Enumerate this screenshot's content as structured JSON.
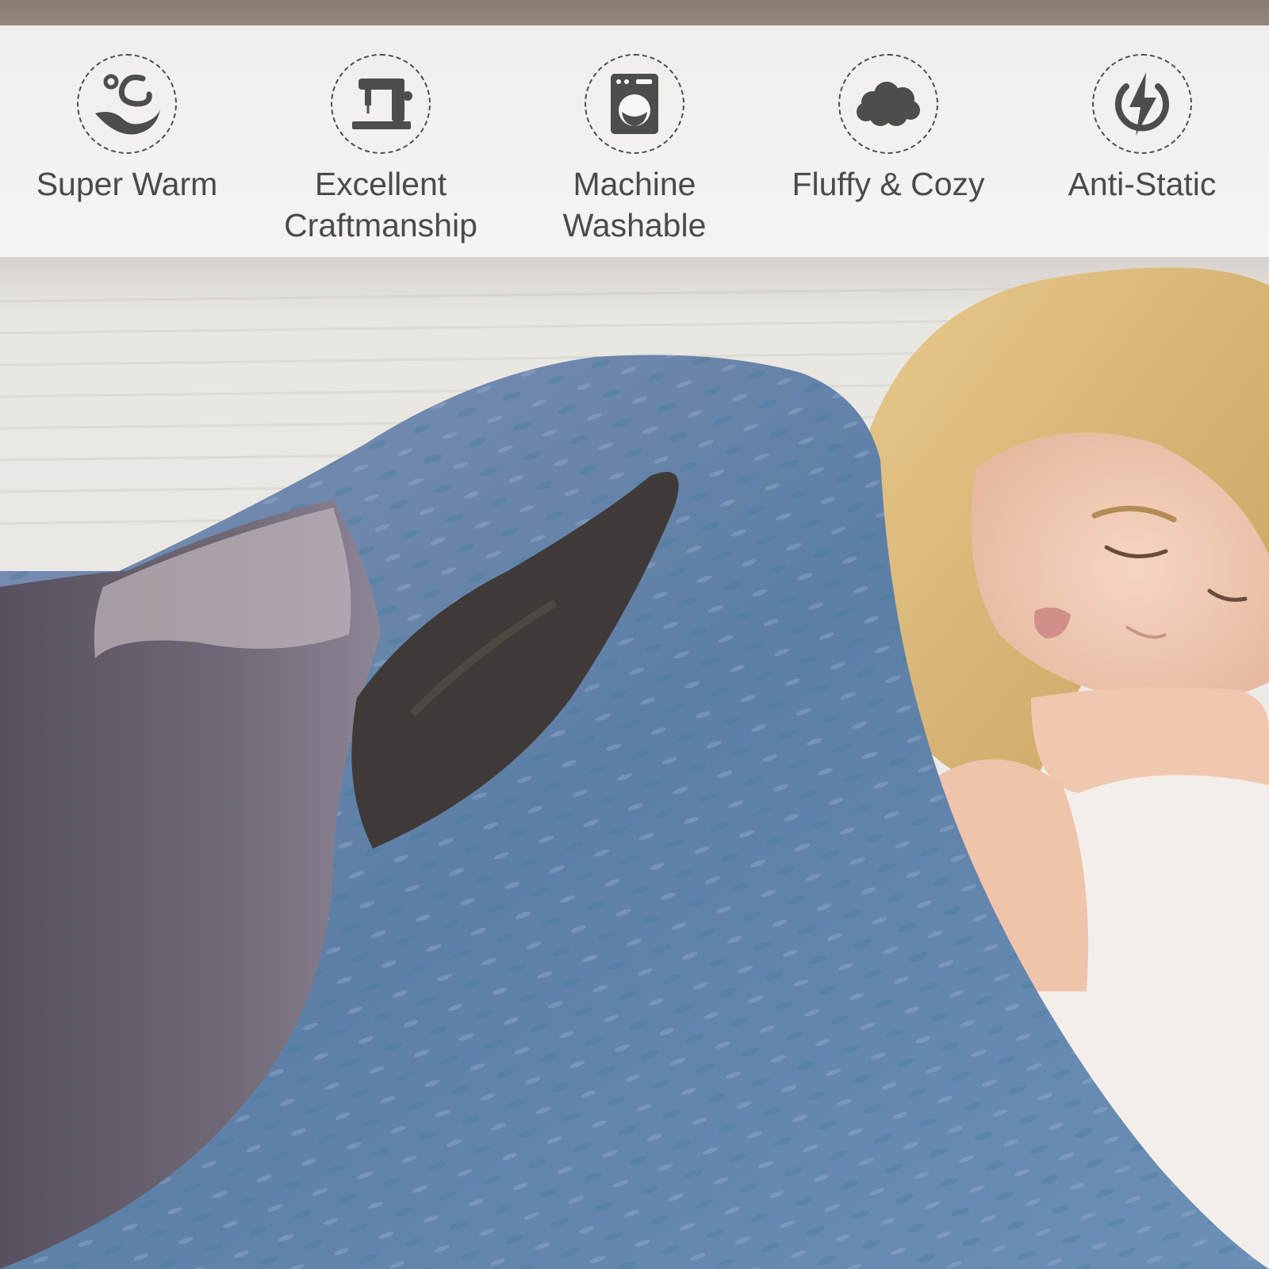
{
  "features": [
    {
      "icon": "warm-wave-icon",
      "lines": [
        "Super Warm"
      ]
    },
    {
      "icon": "sewing-machine-icon",
      "lines": [
        "Excellent",
        "Craftmanship"
      ]
    },
    {
      "icon": "washing-machine-icon",
      "lines": [
        "Machine",
        "Washable"
      ]
    },
    {
      "icon": "cloud-icon",
      "lines": [
        "Fluffy & Cozy"
      ]
    },
    {
      "icon": "lightning-icon",
      "lines": [
        "Anti-Static"
      ]
    }
  ],
  "colors": {
    "banner": "#f7f6f4",
    "icon": "#4d4d4d",
    "text": "#4a4a4a",
    "water": "#5d7fa6",
    "dolphin": "#6a6371",
    "hair": "#d9b877",
    "skin": "#efc9b2"
  }
}
